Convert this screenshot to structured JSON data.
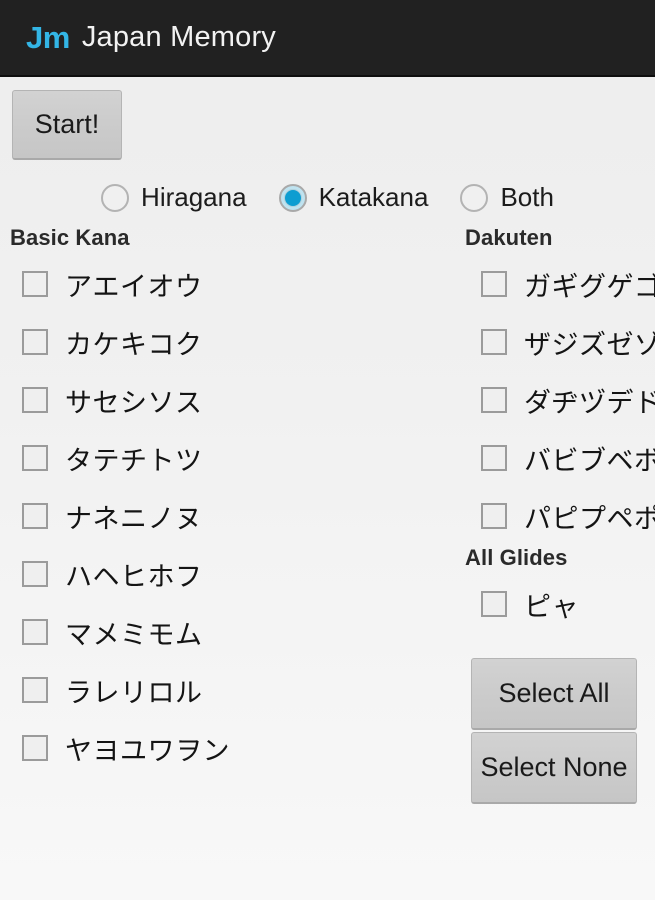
{
  "header": {
    "logo": "Jm",
    "title": "Japan Memory",
    "logo_color": "#33b5e5",
    "bar_color": "#212121"
  },
  "toolbar": {
    "start_label": "Start!"
  },
  "script_selector": {
    "selected": "Katakana",
    "options": [
      {
        "label": "Hiragana",
        "selected": false
      },
      {
        "label": "Katakana",
        "selected": true
      },
      {
        "label": "Both",
        "selected": false
      }
    ]
  },
  "left_column": {
    "heading": "Basic Kana",
    "rows": [
      {
        "label": "アエイオウ",
        "checked": false
      },
      {
        "label": "カケキコク",
        "checked": false
      },
      {
        "label": "サセシソス",
        "checked": false
      },
      {
        "label": "タテチトツ",
        "checked": false
      },
      {
        "label": "ナネニノヌ",
        "checked": false
      },
      {
        "label": "ハヘヒホフ",
        "checked": false
      },
      {
        "label": "マメミモム",
        "checked": false
      },
      {
        "label": "ラレリロル",
        "checked": false
      },
      {
        "label": "ヤヨユワヲン",
        "checked": false
      }
    ]
  },
  "right_column": {
    "dakuten": {
      "heading": "Dakuten",
      "rows": [
        {
          "label": "ガギグゲゴ",
          "checked": false
        },
        {
          "label": "ザジズゼゾ",
          "checked": false
        },
        {
          "label": "ダヂヅデド",
          "checked": false
        },
        {
          "label": "バビブベボ",
          "checked": false
        },
        {
          "label": "パピプペポ",
          "checked": false
        }
      ]
    },
    "glides": {
      "heading": "All Glides",
      "rows": [
        {
          "label": "ピャ",
          "checked": false
        }
      ]
    }
  },
  "actions": {
    "select_all": "Select All",
    "select_none": "Select None"
  }
}
